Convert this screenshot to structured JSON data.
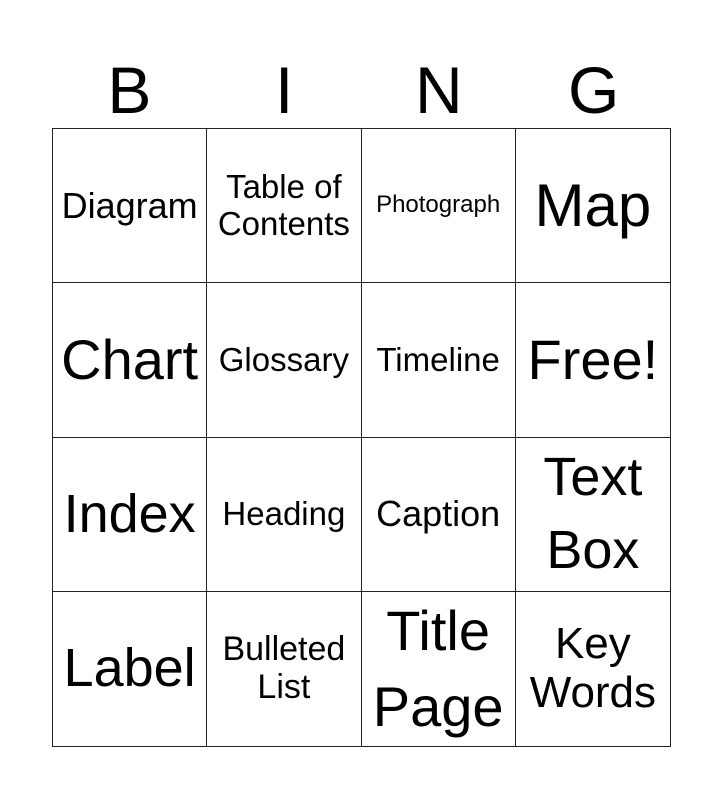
{
  "header": [
    "B",
    "I",
    "N",
    "G"
  ],
  "cells": [
    {
      "text": "Diagram",
      "size": "sz36"
    },
    {
      "text": "Table of Contents",
      "size": "sz32"
    },
    {
      "text": "Photograph",
      "size": "sz24"
    },
    {
      "text": "Map",
      "size": "sz60"
    },
    {
      "text": "Chart",
      "size": "sz56"
    },
    {
      "text": "Glossary",
      "size": "sz32"
    },
    {
      "text": "Timeline",
      "size": "sz32"
    },
    {
      "text": "Free!",
      "size": "sz56"
    },
    {
      "text": "Index",
      "size": "sz54"
    },
    {
      "text": "Heading",
      "size": "sz32"
    },
    {
      "text": "Caption",
      "size": "sz36"
    },
    {
      "text": "Text Box",
      "size": "sz54"
    },
    {
      "text": "Label",
      "size": "sz54"
    },
    {
      "text": "Bulleted List",
      "size": "sz34"
    },
    {
      "text": "Title Page",
      "size": "sz56"
    },
    {
      "text": "Key Words",
      "size": "sz44"
    }
  ]
}
